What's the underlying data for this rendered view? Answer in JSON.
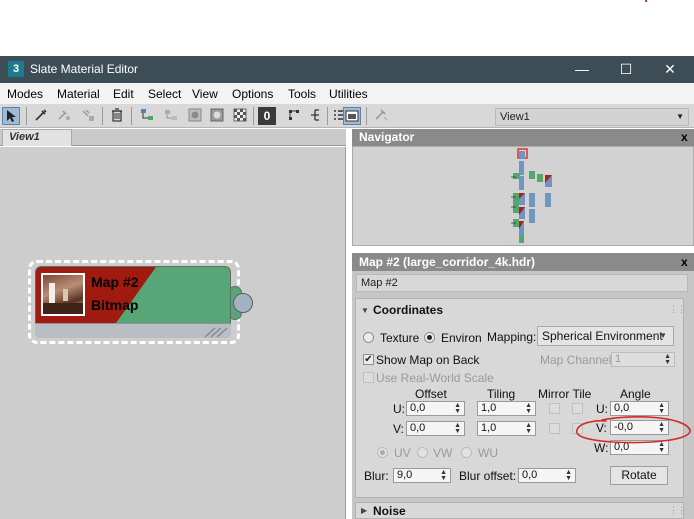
{
  "window": {
    "title": "Slate Material Editor",
    "app_icon": "3",
    "minimize": "—",
    "maximize": "☐",
    "close": "✕"
  },
  "menu": [
    "Modes",
    "Material",
    "Edit",
    "Select",
    "View",
    "Options",
    "Tools",
    "Utilities"
  ],
  "toolbar": {
    "view_select": "View1",
    "icons": [
      "select-arrow-icon",
      "eyedropper-icon",
      "pick-material-icon",
      "put-to-scene-icon",
      "delete-icon",
      "move-children-icon",
      "hide-children-icon",
      "show-background-icon",
      "show-map-icon",
      "checker-icon",
      "zero-icon",
      "layout-all-icon",
      "layout-children-icon",
      "list-icon",
      "properties-icon",
      "lock-icon"
    ]
  },
  "view_panel": {
    "tab": "View1"
  },
  "node": {
    "title": "Map #2",
    "subtitle": "Bitmap"
  },
  "navigator": {
    "title": "Navigator",
    "close": "x"
  },
  "params": {
    "title": "Map #2  (large_corridor_4k.hdr)",
    "close": "x",
    "map_name": "Map #2",
    "rollout": "Coordinates",
    "texture": "Texture",
    "environ": "Environ",
    "mapping_label": "Mapping:",
    "mapping_value": "Spherical Environment",
    "show_map_on_back": "Show Map on Back",
    "map_channel_label": "Map Channel:",
    "map_channel_value": "1",
    "use_real_world": "Use Real-World Scale",
    "col_offset": "Offset",
    "col_tiling": "Tiling",
    "col_mirror_tile": "Mirror Tile",
    "col_angle": "Angle",
    "u": "U:",
    "v": "V:",
    "w": "W:",
    "u_offset": "0,0",
    "v_offset": "0,0",
    "u_tiling": "1,0",
    "v_tiling": "1,0",
    "u_angle": "0,0",
    "v_angle": "-0,0",
    "w_angle": "0,0",
    "uv": "UV",
    "vw": "VW",
    "wu": "WU",
    "blur_label": "Blur:",
    "blur_value": "9,0",
    "blur_offset_label": "Blur offset:",
    "blur_offset_value": "0,0",
    "rotate": "Rotate",
    "noise": "Noise"
  },
  "colors": {
    "titlebar": "#3c4d56",
    "node_green": "#57a677",
    "node_red": "#a01a10",
    "annotation": "#d42a2a"
  }
}
